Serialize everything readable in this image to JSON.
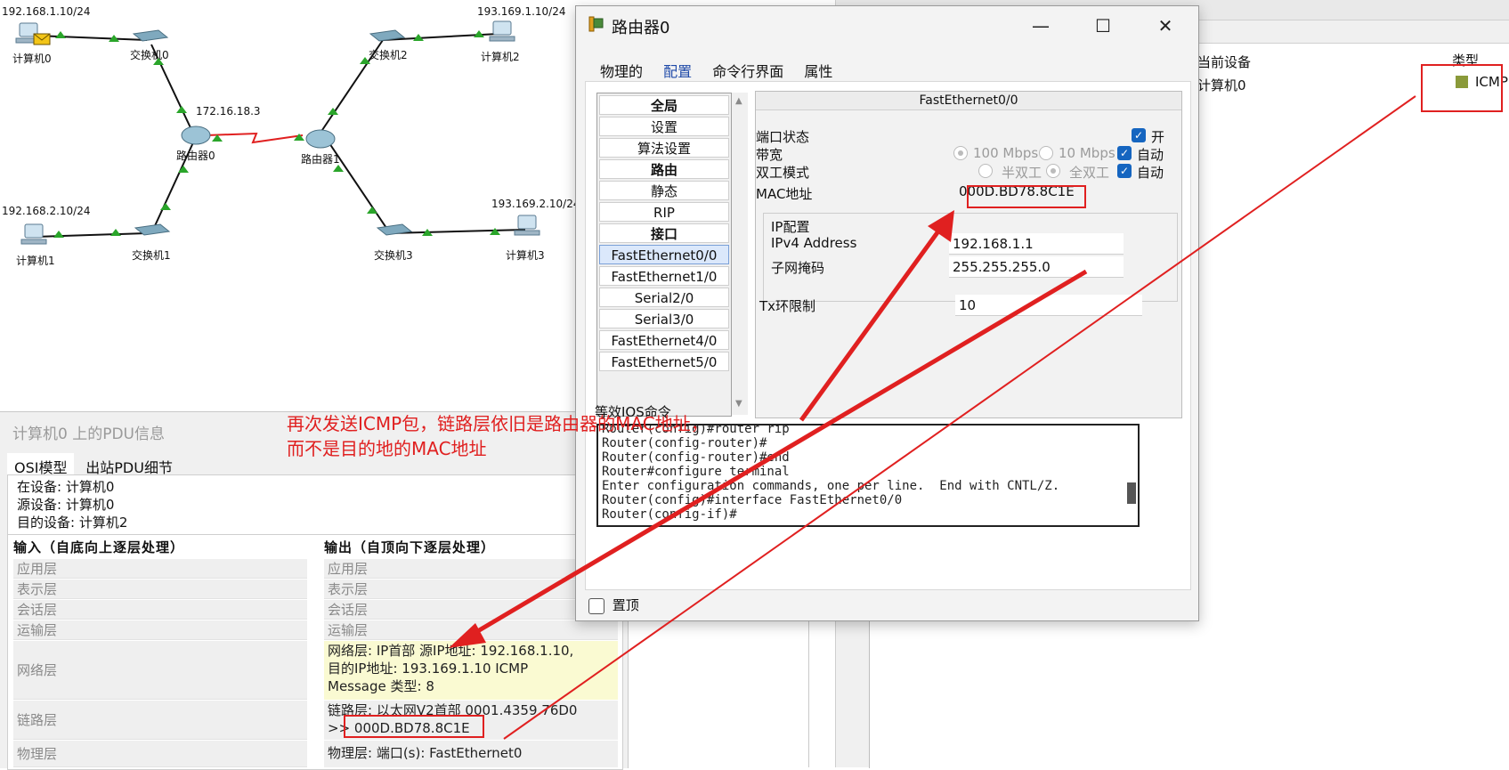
{
  "background": {
    "columns": [
      "当前设备",
      "类型"
    ],
    "row": {
      "device": "计算机0",
      "type": "ICMP"
    },
    "type_color": "#8a9a3a"
  },
  "topology": {
    "ip_labels": {
      "pc0": "192.168.1.10/24",
      "pc1": "192.168.2.10/24",
      "pc2": "193.169.1.10/24",
      "pc3": "193.169.2.10/24",
      "router0": "172.16.18.3"
    },
    "devices": {
      "pc0": "计算机0",
      "pc1": "计算机1",
      "pc2": "计算机2",
      "pc3": "计算机3",
      "sw0": "交换机0",
      "sw1": "交换机1",
      "sw2": "交换机2",
      "sw3": "交换机3",
      "r0": "路由器0",
      "r1": "路由器1"
    },
    "link_color": "#111111",
    "serial_color": "#e02020",
    "port_color": "#2aa52a"
  },
  "pdu": {
    "title": "计算机0 上的PDU信息",
    "tabs": [
      "OSI模型",
      "出站PDU细节"
    ],
    "at_device": "在设备: 计算机0",
    "source_device": "源设备: 计算机0",
    "dest_device": "目的设备: 计算机2",
    "in_header": "输入（自底向上逐层处理）",
    "out_header": "输出（自顶向下逐层处理）",
    "in_layers": [
      "应用层",
      "表示层",
      "会话层",
      "运输层",
      "网络层",
      "链路层",
      "物理层"
    ],
    "out_layers": [
      "应用层",
      "表示层",
      "会话层",
      "运输层"
    ],
    "out_network": [
      "网络层: IP首部 源IP地址: 192.168.1.10,",
      "目的IP地址: 193.169.1.10 ICMP",
      "Message 类型: 8"
    ],
    "out_link_1": "链路层: 以太网V2首部 0001.4359.76D0",
    "out_link_prefix": ">>",
    "out_link_mac": "000D.BD78.8C1E",
    "out_physical": "物理层: 端口(s): FastEthernet0"
  },
  "dialog": {
    "title": "路由器0",
    "close": "✕",
    "maximize": "☐",
    "minimize": "—",
    "tabs": [
      "物理的",
      "配置",
      "命令行界面",
      "属性"
    ],
    "nav": [
      "全局",
      "设置",
      "算法设置",
      "路由",
      "静态",
      "RIP",
      "接口",
      "FastEthernet0/0",
      "FastEthernet1/0",
      "Serial2/0",
      "Serial3/0",
      "FastEthernet4/0",
      "FastEthernet5/0"
    ],
    "panel_title": "FastEthernet0/0",
    "port_status_label": "端口状态",
    "port_on": "开",
    "bandwidth_label": "带宽",
    "bw_100": "100 Mbps",
    "bw_10": "10 Mbps",
    "auto": "自动",
    "duplex_label": "双工模式",
    "half": "半双工",
    "full": "全双工",
    "mac_label": "MAC地址",
    "mac_value": "000D.BD78.8C1E",
    "ip_config_label": "IP配置",
    "ipv4_label": "IPv4 Address",
    "ipv4_value": "192.168.1.1",
    "mask_label": "子网掩码",
    "mask_value": "255.255.255.0",
    "tx_label": "Tx环限制",
    "tx_value": "10",
    "ios_label": "等效IOS命令",
    "ios_lines": [
      "Router(config)#router rip",
      "Router(config-router)#",
      "Router(config-router)#end",
      "Router#configure terminal",
      "Enter configuration commands, one per line.  End with CNTL/Z.",
      "Router(config)#interface FastEthernet0/0",
      "Router(config-if)#"
    ],
    "pin_label": "置顶"
  },
  "annotation": {
    "line1": "再次发送ICMP包，链路层依旧是路由器的MAC地址，",
    "line2": "而不是目的地的MAC地址",
    "color": "#e02020"
  }
}
